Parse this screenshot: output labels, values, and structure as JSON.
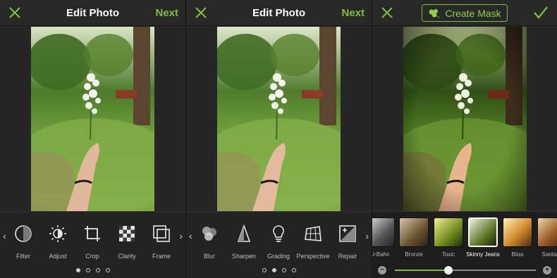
{
  "panels": [
    {
      "title": "Edit Photo",
      "next_label": "Next",
      "tools": [
        {
          "label": "Filter",
          "icon": "filter-icon"
        },
        {
          "label": "Adjust",
          "icon": "adjust-icon"
        },
        {
          "label": "Crop",
          "icon": "crop-icon"
        },
        {
          "label": "Clarity",
          "icon": "clarity-icon"
        },
        {
          "label": "Frame",
          "icon": "frame-icon"
        }
      ],
      "page_indicator": {
        "pages": 4,
        "active": 1
      }
    },
    {
      "title": "Edit Photo",
      "next_label": "Next",
      "tools": [
        {
          "label": "Blur",
          "icon": "blur-icon"
        },
        {
          "label": "Sharpen",
          "icon": "sharpen-icon"
        },
        {
          "label": "Grading",
          "icon": "grading-icon"
        },
        {
          "label": "Perspective",
          "icon": "perspective-icon"
        },
        {
          "label": "Repair",
          "icon": "repair-icon"
        }
      ],
      "page_indicator": {
        "pages": 4,
        "active": 2
      }
    },
    {
      "mask_label": "Create Mask",
      "filters": [
        {
          "label": "U-Bahn"
        },
        {
          "label": "Bronze"
        },
        {
          "label": "Toxic"
        },
        {
          "label": "Skinny Jeans",
          "selected": true
        },
        {
          "label": "Bliss"
        },
        {
          "label": "Santa C"
        }
      ],
      "strength": 0.38
    }
  ],
  "colors": {
    "accent": "#7fbf3c",
    "background": "#262626",
    "toolbar": "#232323"
  }
}
